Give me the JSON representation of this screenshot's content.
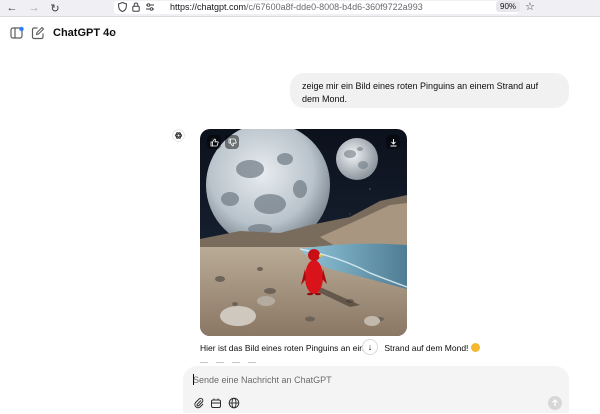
{
  "browser": {
    "url_host": "https://chatgpt.com",
    "url_path": "/c/67600a8f-dde0-8008-b4d6-360f9722a993",
    "zoom": "90%"
  },
  "header": {
    "model": "ChatGPT 4o"
  },
  "user_message": {
    "text": "zeige mir ein Bild eines roten Pinguins an einem Strand auf dem Mond."
  },
  "assistant_message": {
    "text_before": "Hier ist das Bild eines roten Pinguins an ein",
    "text_after": " Strand auf dem Mond! "
  },
  "composer": {
    "placeholder": "Sende eine Nachricht an ChatGPT"
  },
  "colors": {
    "accent": "#0d0d0d",
    "penguin": "#d8141a",
    "new_chat_dot": "#2f7cf6"
  }
}
